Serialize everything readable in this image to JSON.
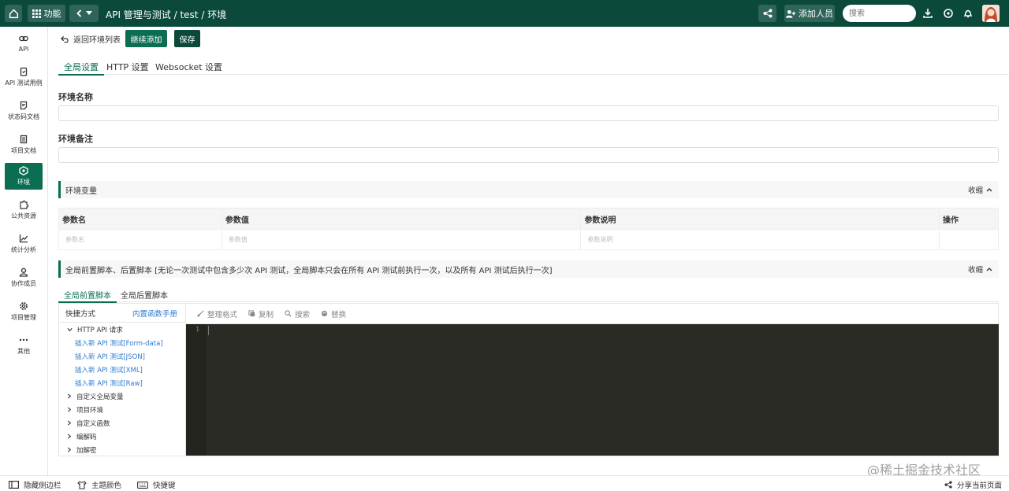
{
  "topbar": {
    "func_label": "功能",
    "crumb": "API 管理与测试  / test / 环境",
    "add_member_label": "添加人员",
    "search_placeholder": "搜索"
  },
  "sidebar": {
    "items": [
      {
        "label": "API",
        "icon": "link-icon"
      },
      {
        "label": "API 测试用例",
        "icon": "clipboard-icon"
      },
      {
        "label": "状态码文档",
        "icon": "doc-icon"
      },
      {
        "label": "项目文档",
        "icon": "book-icon"
      },
      {
        "label": "环境",
        "icon": "cube-icon"
      },
      {
        "label": "公共资源",
        "icon": "puzzle-icon"
      },
      {
        "label": "统计分析",
        "icon": "chart-icon"
      },
      {
        "label": "协作成员",
        "icon": "user-icon"
      },
      {
        "label": "项目管理",
        "icon": "gear-icon"
      },
      {
        "label": "其他",
        "icon": "more-icon"
      }
    ]
  },
  "actions": {
    "back_label": "返回环境列表",
    "continue_label": "继续添加",
    "save_label": "保存"
  },
  "settings_tabs": [
    "全局设置",
    "HTTP 设置",
    "Websocket 设置"
  ],
  "form": {
    "env_name_label": "环境名称",
    "env_note_label": "环境备注"
  },
  "env_vars": {
    "title": "环境变量",
    "collapse_label": "收缩",
    "columns": [
      "参数名",
      "参数值",
      "参数说明",
      "操作"
    ],
    "placeholders": [
      "参数名",
      "参数值",
      "参数说明"
    ]
  },
  "scripts": {
    "title": "全局前置脚本、后置脚本 [无论一次测试中包含多少次 API 测试，全局脚本只会在所有 API 测试前执行一次，以及所有 API 测试后执行一次]",
    "collapse_label": "收缩",
    "tabs": [
      "全局前置脚本",
      "全局后置脚本"
    ],
    "shortcut_label": "快捷方式",
    "manual_link": "内置函数手册",
    "tree": [
      {
        "label": "HTTP API 请求",
        "expanded": true,
        "children": [
          "插入新 API 测试[Form-data]",
          "插入新 API 测试[JSON]",
          "插入新 API 测试[XML]",
          "插入新 API 测试[Raw]"
        ]
      },
      {
        "label": "自定义全局变量"
      },
      {
        "label": "项目环境"
      },
      {
        "label": "自定义函数"
      },
      {
        "label": "编解码"
      },
      {
        "label": "加解密"
      }
    ],
    "toolbar": [
      "整理格式",
      "复制",
      "搜索",
      "替换"
    ],
    "line_number": "1"
  },
  "footer": {
    "hide_sidebar": "隐藏侧边栏",
    "theme_color": "主题颜色",
    "shortcuts": "快捷键",
    "share_page": "分享当前页面"
  },
  "watermark": "@稀土掘金技术社区",
  "colors": {
    "topbar": "#0b4a3b",
    "accent": "#0b6e52",
    "link": "#2d7bd1",
    "editor": "#2b2b26"
  }
}
